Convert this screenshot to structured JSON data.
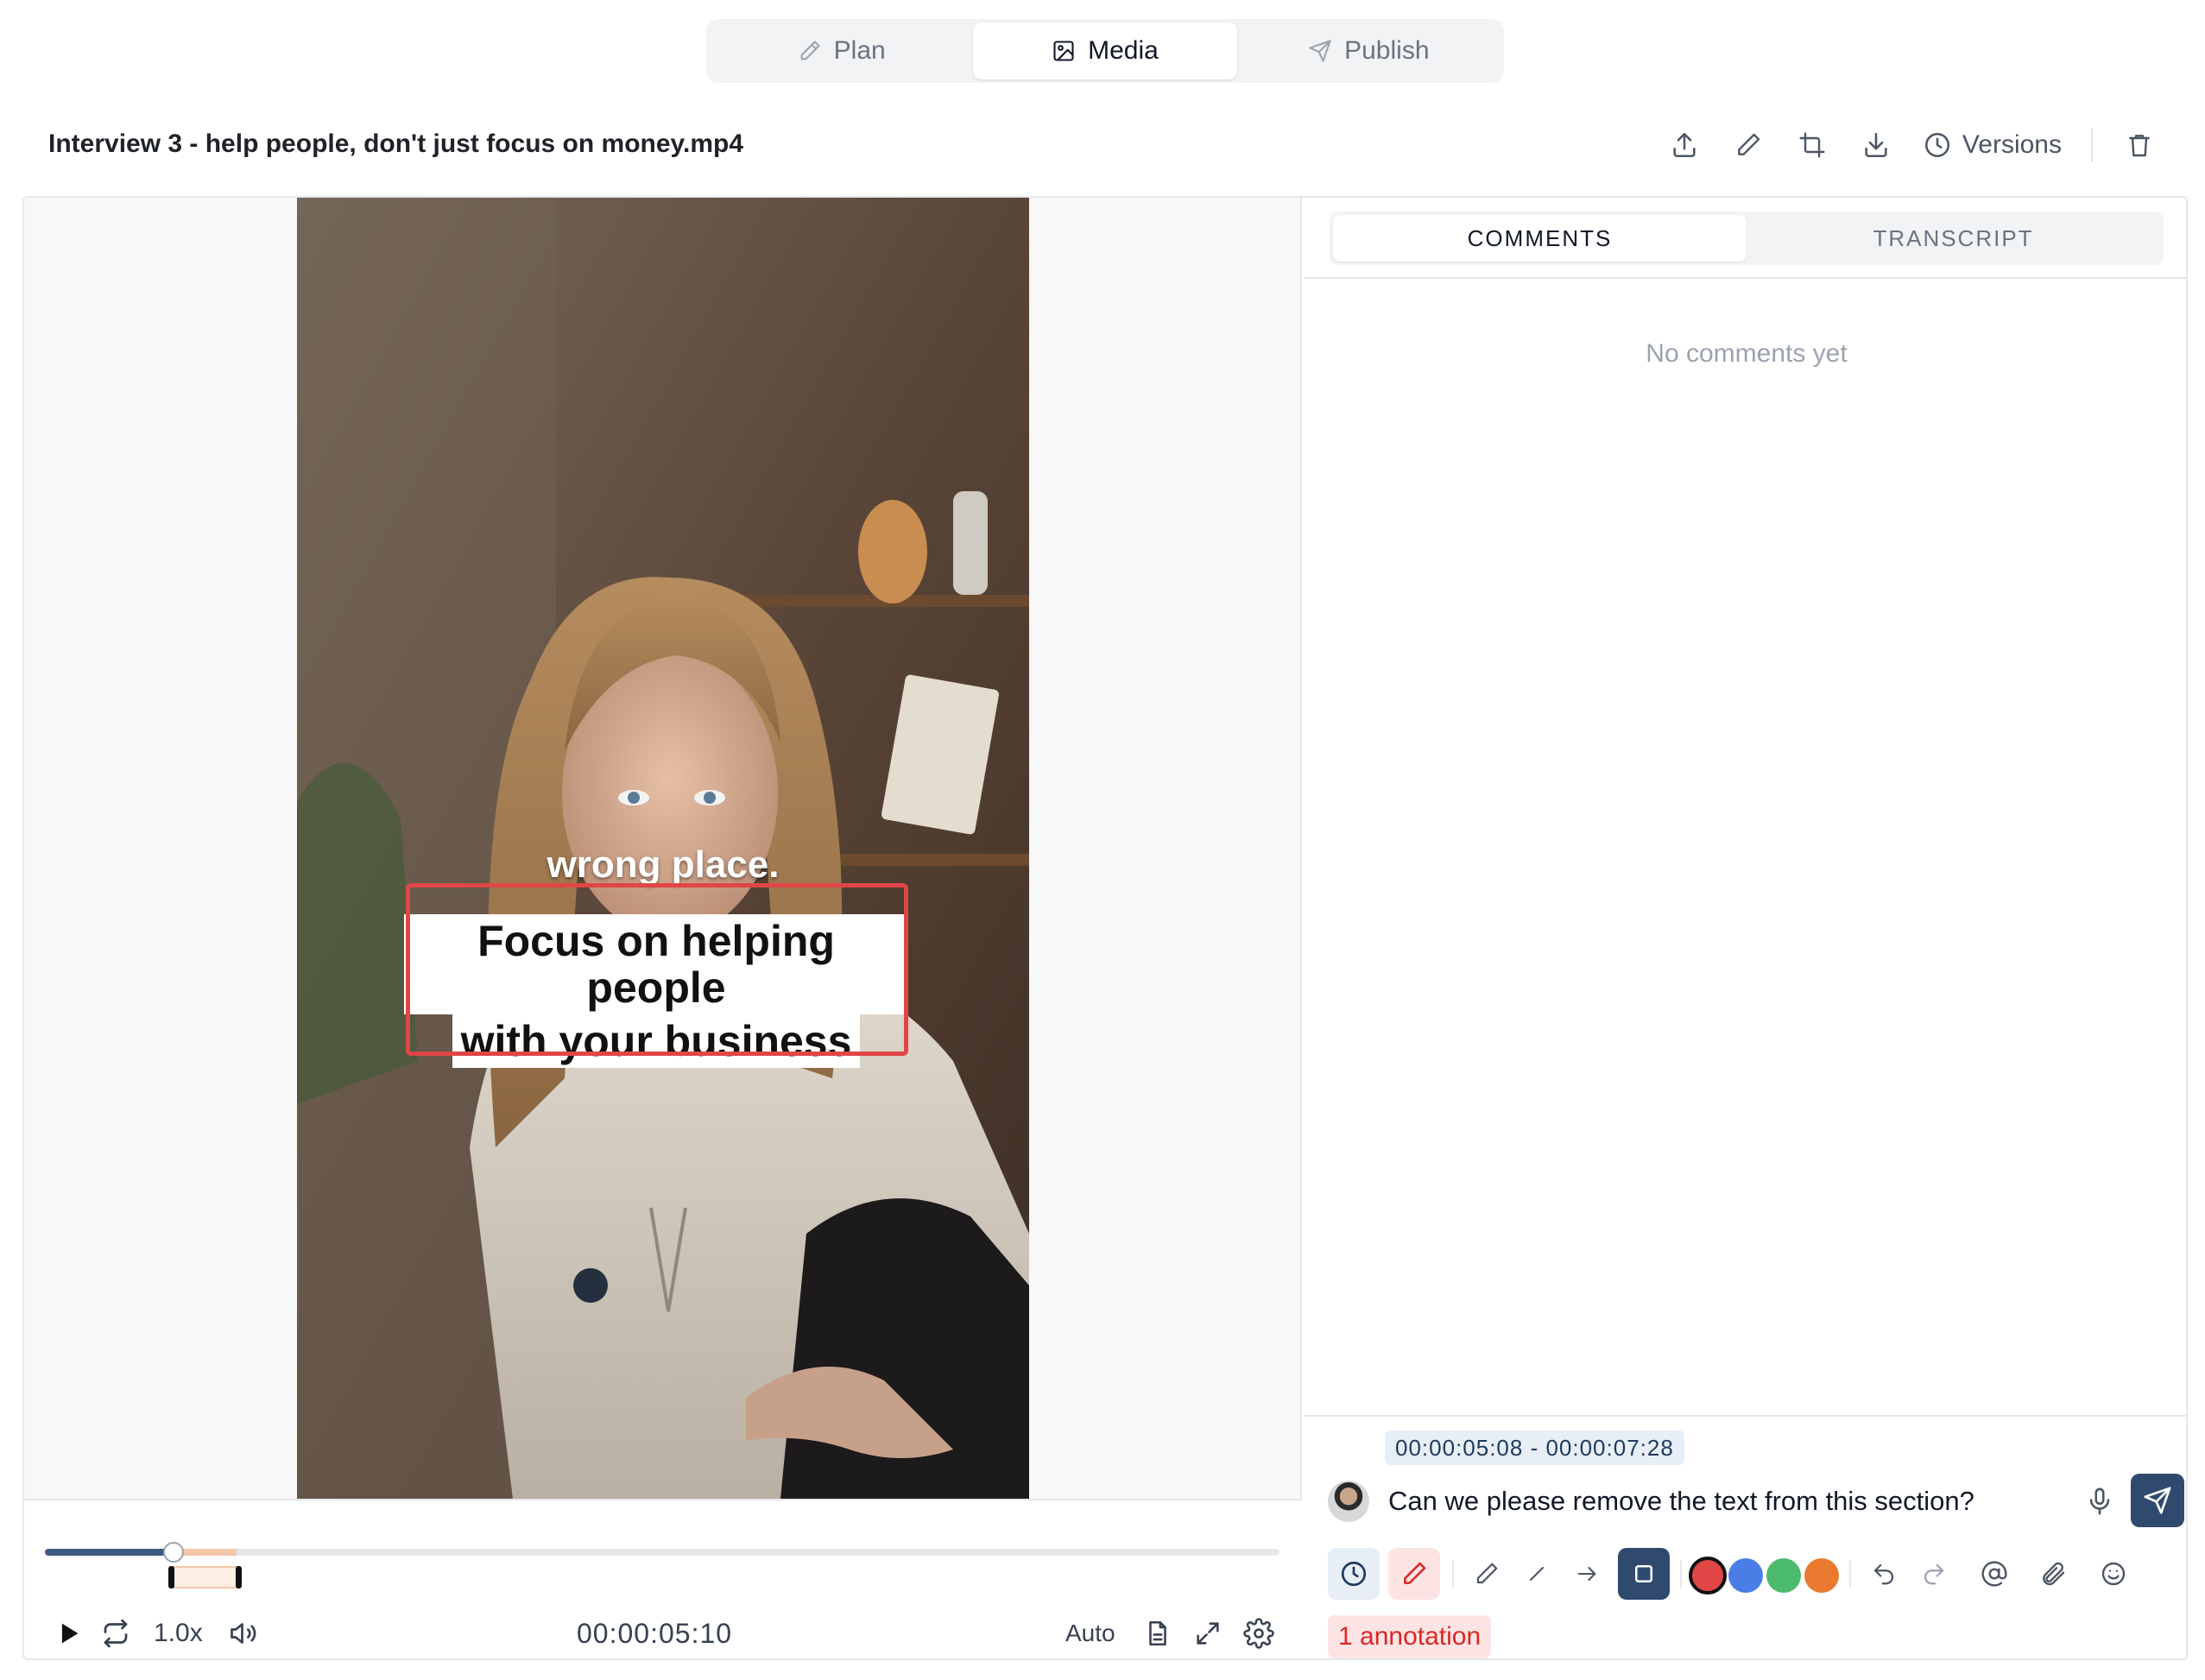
{
  "nav": {
    "tabs": [
      {
        "label": "Plan",
        "icon": "pencil-icon"
      },
      {
        "label": "Media",
        "icon": "image-icon"
      },
      {
        "label": "Publish",
        "icon": "send-icon"
      }
    ],
    "active": "Media"
  },
  "header": {
    "file_title": "Interview 3 - help people, don't just focus on money.mp4",
    "versions_label": "Versions"
  },
  "video": {
    "caption_top": "wrong place.",
    "caption_line1": "Focus on helping people",
    "caption_line2": "with your business"
  },
  "player": {
    "speed": "1.0x",
    "timecode": "00:00:05:10",
    "quality": "Auto",
    "progress": 0.104,
    "range_start": 0.104,
    "range_end": 0.155
  },
  "panel": {
    "tabs": [
      "COMMENTS",
      "TRANSCRIPT"
    ],
    "active_tab": "COMMENTS",
    "empty_text": "No comments yet"
  },
  "composer": {
    "range": "00:00:05:08 - 00:00:07:28",
    "message": "Can we please remove the text from this section?",
    "colors": [
      "#e04646",
      "#4a7ee6",
      "#4cbb6c",
      "#ea7a30"
    ],
    "selected_color": "#e04646",
    "annotation_count_label": "1 annotation"
  }
}
